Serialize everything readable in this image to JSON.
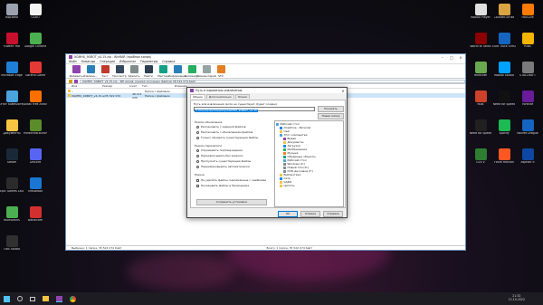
{
  "desktop": {
    "left_icons": [
      {
        "label": "Корзина",
        "color": "#9aa3ad"
      },
      {
        "label": "GSRO",
        "color": "#f3f3f3"
      },
      {
        "label": "Клиент Hot",
        "color": "#c8102e"
      },
      {
        "label": "Google Chrome",
        "color": "#4caf50"
      },
      {
        "label": "Microsoft Edge",
        "color": "#1f7fd6"
      },
      {
        "label": "Garena Game",
        "color": "#e53935"
      },
      {
        "label": "Этот компьютер",
        "color": "#4aa3df"
      },
      {
        "label": "Avast Free Antivirus",
        "color": "#ff6f00"
      },
      {
        "label": "Документы",
        "color": "#f6c342"
      },
      {
        "label": "MinecraftLauncher",
        "color": "#5b8c2a"
      },
      {
        "label": "Steam",
        "color": "#1b2838"
      },
      {
        "label": "Discord",
        "color": "#5865f2"
      },
      {
        "label": "Epic Games Launcher",
        "color": "#2b2b2b"
      },
      {
        "label": "VirtualBox",
        "color": "#1976d2"
      },
      {
        "label": "BlueStacks",
        "color": "#4caf50"
      },
      {
        "label": "Bandicam",
        "color": "#d32f2f"
      },
      {
        "label": "OBS Studio",
        "color": "#303030"
      }
    ],
    "right_icons": [
      {
        "label": "Roblox Player",
        "color": "#e0e0e0"
      },
      {
        "label": "Counter-Strike",
        "color": "#d9a441"
      },
      {
        "label": "Half-Life",
        "color": "#ff7a00"
      },
      {
        "label": "World of Tanks",
        "color": "#8b0000"
      },
      {
        "label": "Euro Truck Simulator",
        "color": "#1565c0"
      },
      {
        "label": "PUBG",
        "color": "#f4b400"
      },
      {
        "label": "Minecraft",
        "color": "#6aa84f"
      },
      {
        "label": "Roblox Studio",
        "color": "#00a2ff"
      },
      {
        "label": "STALCRAFT",
        "color": "#7a7a7a"
      },
      {
        "label": "Rust",
        "color": "#cd412b"
      },
      {
        "label": "Need for Speed",
        "color": "#111111"
      },
      {
        "label": "Fortnite",
        "color": "#6a1b9a"
      },
      {
        "label": "Need for Speed",
        "color": "#202020"
      },
      {
        "label": "Spotify",
        "color": "#1db954"
      },
      {
        "label": "Rocket League",
        "color": "#1565c0"
      },
      {
        "label": "GTA V",
        "color": "#2e7d32"
      },
      {
        "label": "Forza Horizon",
        "color": "#ff5722"
      },
      {
        "label": "Asphalt 9",
        "color": "#0d47a1"
      }
    ]
  },
  "rar_window": {
    "title": "XGMHX_9OBOT_v4.15.zip - WinRAR (пробная копия)",
    "menu": [
      "Файл",
      "Команды",
      "Операции",
      "Избранное",
      "Параметры",
      "Справка"
    ],
    "toolbar": [
      {
        "label": "Добавить",
        "color": "#8e44ad"
      },
      {
        "label": "Извлечь...",
        "color": "#2980b9"
      },
      {
        "label": "Тест",
        "color": "#c0392b"
      },
      {
        "label": "Просмотр",
        "color": "#34495e"
      },
      {
        "label": "Удалить",
        "color": "#7f8c8d"
      },
      {
        "label": "Найти",
        "color": "#2c3e50"
      },
      {
        "label": "Мастер",
        "color": "#16a085"
      },
      {
        "label": "Информация",
        "color": "#2980b9"
      },
      {
        "label": "Антивирус",
        "color": "#27ae60"
      },
      {
        "label": "Комментарий",
        "color": "#95a5a6"
      },
      {
        "label": "SFX",
        "color": "#e67e22"
      }
    ],
    "path": "XGMHX_9OBOT_v4.15.zip - ZIP архив, размер исходных файлов 36 522 074 байт",
    "columns": [
      "Имя",
      "Размер",
      "Сжат",
      "Тип",
      "Изменён"
    ],
    "rows": [
      {
        "name": "..",
        "size": "",
        "packed": "",
        "type": "Папка с файлами",
        "selected": false
      },
      {
        "name": "XGMHX_9OBOT_v4.15.exe",
        "size": "35 522 074",
        "packed": "48 121 235",
        "type": "Папка с файлами",
        "selected": true
      }
    ],
    "status_left": "Выбрано: 1 папка, 35 522 074 байт",
    "status_right": "Всего: 1 папка, 35 522 074 байт"
  },
  "dialog": {
    "title": "Путь и параметры извлечения",
    "tabs": [
      "Общие",
      "Дополнительно",
      "Опции"
    ],
    "dest_label": "Путь для извлечения (если не существует, будет создан)",
    "dest_value": "C:\\Users\\User\\Desktop\\XGMHX_9OBOT_v4.15",
    "show_button": "Показать",
    "new_folder_button": "Новая папка",
    "update_group": "Режим обновления",
    "update_options": [
      {
        "label": "Распаковать с заменой файлов",
        "checked": true
      },
      {
        "label": "Распаковать с обновлением файлов",
        "checked": false
      },
      {
        "label": "Только обновить существующие файлы",
        "checked": false
      }
    ],
    "overwrite_group": "Режим перезаписи",
    "overwrite_options": [
      {
        "label": "Спрашивать подтверждение",
        "checked": true
      },
      {
        "label": "Перезаписывать без запроса",
        "checked": false
      },
      {
        "label": "Пропускать существующие файлы",
        "checked": false
      },
      {
        "label": "Переименовывать автоматически",
        "checked": false
      }
    ],
    "misc_group": "Разное",
    "misc_options": [
      {
        "label": "Не удалять файлы, извлечённые с ошибками",
        "checked": false
      },
      {
        "label": "Показывать файлы в Проводнике",
        "checked": false
      }
    ],
    "save_button": "Сохранить установки",
    "tree": [
      {
        "label": "Рабочий стол",
        "indent": 0,
        "color": "#4aa3df"
      },
      {
        "label": "OneDrive - Personal",
        "indent": 1,
        "color": "#1e88e5"
      },
      {
        "label": "User",
        "indent": 1,
        "color": "#f6c342"
      },
      {
        "label": "Этот компьютер",
        "indent": 1,
        "color": "#4aa3df"
      },
      {
        "label": "Видео",
        "indent": 2,
        "color": "#8e44ad"
      },
      {
        "label": "Документы",
        "indent": 2,
        "color": "#f6c342"
      },
      {
        "label": "Загрузки",
        "indent": 2,
        "color": "#1e88e5"
      },
      {
        "label": "Изображения",
        "indent": 2,
        "color": "#27ae60"
      },
      {
        "label": "Музыка",
        "indent": 2,
        "color": "#e67e22"
      },
      {
        "label": "Объёмные объекты",
        "indent": 2,
        "color": "#16a085"
      },
      {
        "label": "Рабочий стол",
        "indent": 2,
        "color": "#4aa3df"
      },
      {
        "label": "Windows (C:)",
        "indent": 2,
        "color": "#7f8c8d"
      },
      {
        "label": "Новый том (D:)",
        "indent": 2,
        "color": "#7f8c8d"
      },
      {
        "label": "DVD-дисковод (F:)",
        "indent": 2,
        "color": "#7f8c8d"
      },
      {
        "label": "Библиотеки",
        "indent": 1,
        "color": "#f6c342"
      },
      {
        "label": "Сеть",
        "indent": 1,
        "color": "#1e88e5"
      },
      {
        "label": "GSRO",
        "indent": 1,
        "color": "#f6c342"
      },
      {
        "label": "Цитаты",
        "indent": 1,
        "color": "#f6c342"
      }
    ],
    "ok_button": "OK",
    "cancel_button": "Отмена",
    "help_button": "Справка"
  },
  "taskbar": {
    "time": "21:32",
    "date": "12.10.2022"
  }
}
